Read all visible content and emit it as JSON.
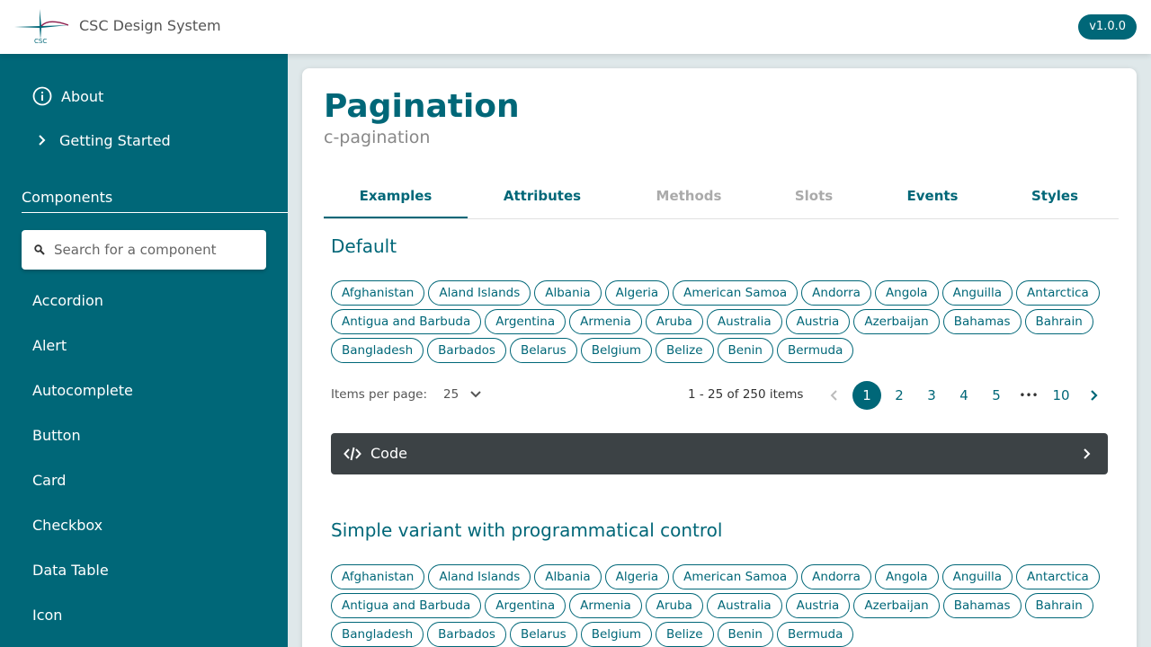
{
  "header": {
    "logo_text": "CSC",
    "app_title": "CSC Design System",
    "version": "v1.0.0"
  },
  "sidebar": {
    "top_items": [
      {
        "label": "About",
        "icon": "info-icon"
      },
      {
        "label": "Getting Started",
        "icon": "chevron-right-icon"
      }
    ],
    "section_title": "Components",
    "search": {
      "placeholder": "Search for a component",
      "icon": "search-icon"
    },
    "items": [
      "Accordion",
      "Alert",
      "Autocomplete",
      "Button",
      "Card",
      "Checkbox",
      "Data Table",
      "Icon"
    ]
  },
  "main": {
    "title": "Pagination",
    "subtitle": "c-pagination",
    "tabs": [
      {
        "label": "Examples",
        "active": true
      },
      {
        "label": "Attributes"
      },
      {
        "label": "Methods",
        "disabled": true
      },
      {
        "label": "Slots",
        "disabled": true
      },
      {
        "label": "Events"
      },
      {
        "label": "Styles"
      }
    ],
    "sections": [
      {
        "title": "Default",
        "chips": [
          "Afghanistan",
          "Aland Islands",
          "Albania",
          "Algeria",
          "American Samoa",
          "Andorra",
          "Angola",
          "Anguilla",
          "Antarctica",
          "Antigua and Barbuda",
          "Argentina",
          "Armenia",
          "Aruba",
          "Australia",
          "Austria",
          "Azerbaijan",
          "Bahamas",
          "Bahrain",
          "Bangladesh",
          "Barbados",
          "Belarus",
          "Belgium",
          "Belize",
          "Benin",
          "Bermuda"
        ]
      },
      {
        "title": "Simple variant with programmatical control",
        "chips": [
          "Afghanistan",
          "Aland Islands",
          "Albania",
          "Algeria",
          "American Samoa",
          "Andorra",
          "Angola",
          "Anguilla",
          "Antarctica",
          "Antigua and Barbuda",
          "Argentina",
          "Armenia",
          "Aruba",
          "Australia",
          "Austria",
          "Azerbaijan",
          "Bahamas",
          "Bahrain",
          "Bangladesh",
          "Barbados",
          "Belarus",
          "Belgium",
          "Belize",
          "Benin",
          "Bermuda"
        ]
      }
    ],
    "pagination": {
      "items_per_page_label": "Items per page:",
      "items_per_page_value": "25",
      "range_text": "1 - 25 of 250 items",
      "pages": [
        "1",
        "2",
        "3",
        "4",
        "5"
      ],
      "ellipsis": "•••",
      "last_page": "10",
      "current_page": "1"
    },
    "code_bar": {
      "label": "Code",
      "icon": "code-icon"
    }
  },
  "colors": {
    "primary": "#006778",
    "code_bg": "#3c4245",
    "header_bg": "#ffffff"
  }
}
